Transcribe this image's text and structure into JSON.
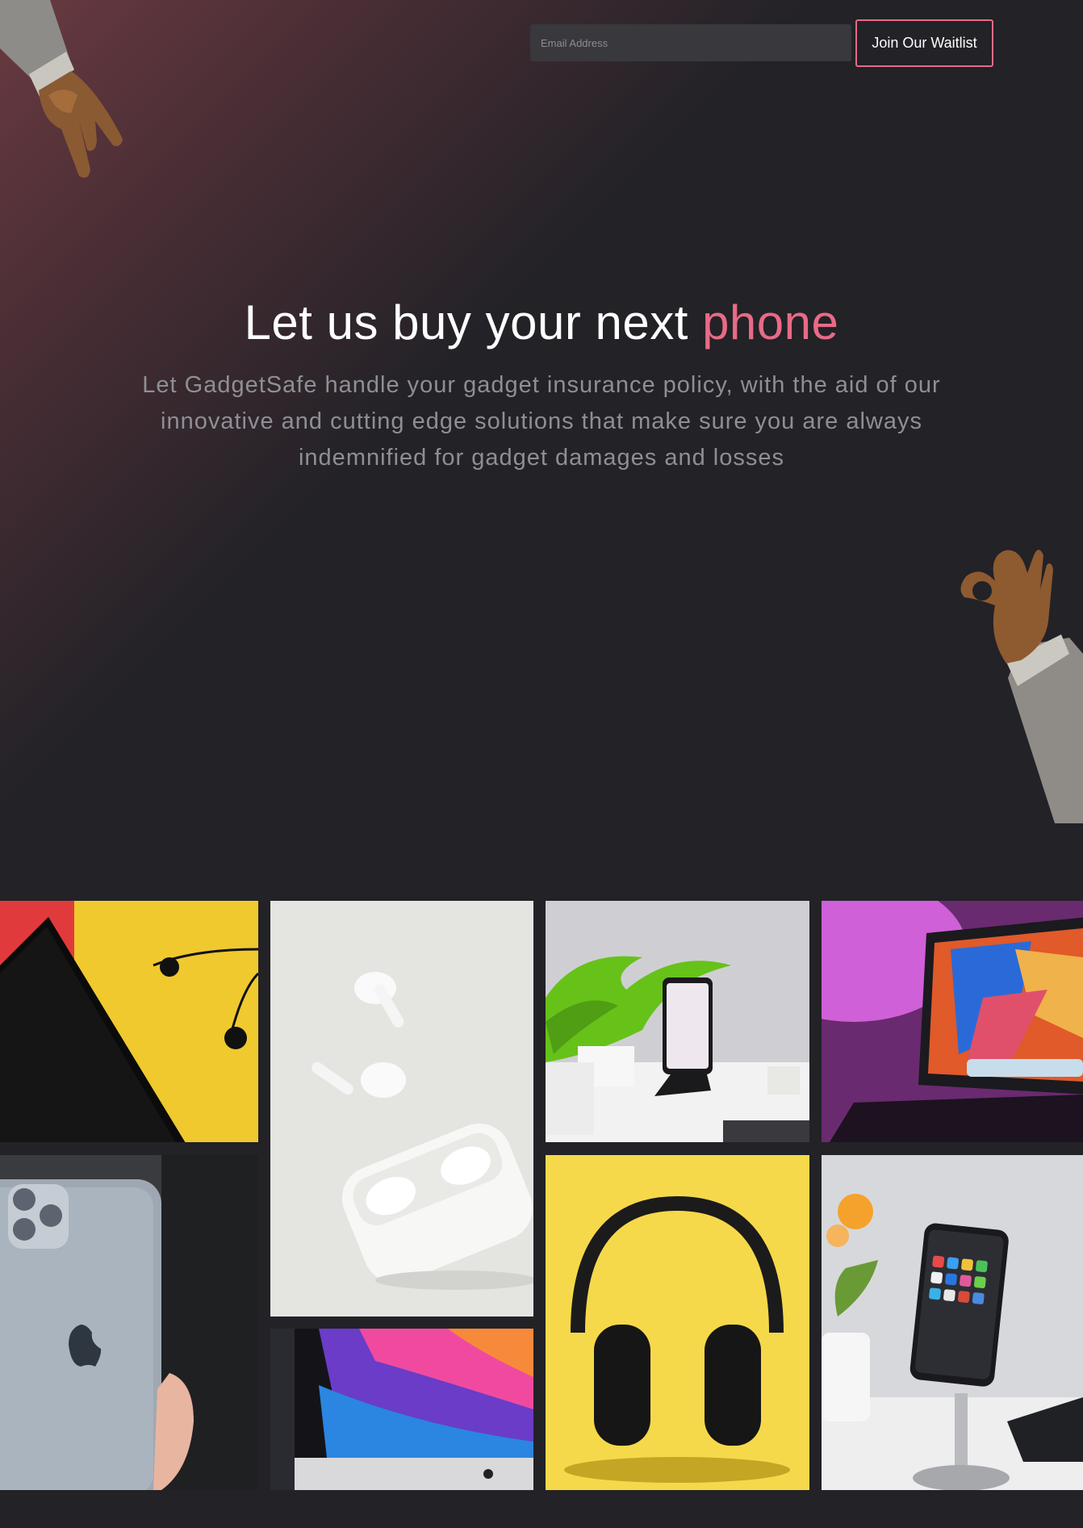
{
  "header": {
    "email_placeholder": "Email Address",
    "join_label": "Join Our Waitlist"
  },
  "hero": {
    "title_main": "Let us buy your next ",
    "title_accent": "phone",
    "subtitle": "Let GadgetSafe handle your gadget insurance policy, with the aid of our innovative and cutting edge solutions that make sure you are always indemnified for gadget damages and losses"
  },
  "colors": {
    "background": "#222227",
    "accent": "#e96a86",
    "button_border": "#e86a85",
    "subtitle": "#8e8f96"
  },
  "gallery": {
    "images": [
      "black-smartphone-with-earphones-on-yellow-red",
      "white-airpods-pro-with-case",
      "iphone-on-stand-with-plant",
      "ipad-with-keyboard-pink-light",
      "silver-iphone-back-in-hand",
      "imac-colorful-wallpaper",
      "black-headphones-on-yellow",
      "iphone-on-stand-with-flowers"
    ]
  }
}
